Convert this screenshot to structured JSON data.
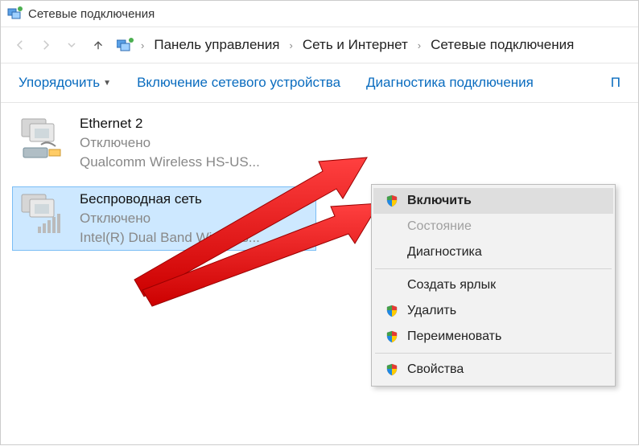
{
  "window": {
    "title": "Сетевые подключения"
  },
  "breadcrumb": {
    "items": [
      "Панель управления",
      "Сеть и Интернет",
      "Сетевые подключения"
    ]
  },
  "toolbar": {
    "organize": "Упорядочить",
    "enable": "Включение сетевого устройства",
    "diagnose": "Диагностика подключения",
    "more": "П"
  },
  "adapters": [
    {
      "name": "Ethernet 2",
      "status": "Отключено",
      "detail": "Qualcomm Wireless HS-US..."
    },
    {
      "name": "Беспроводная сеть",
      "status": "Отключено",
      "detail": "Intel(R) Dual Band Wireless..."
    }
  ],
  "context_menu": {
    "enable": "Включить",
    "status": "Состояние",
    "diagnose": "Диагностика",
    "shortcut": "Создать ярлык",
    "delete": "Удалить",
    "rename": "Переименовать",
    "properties": "Свойства"
  }
}
